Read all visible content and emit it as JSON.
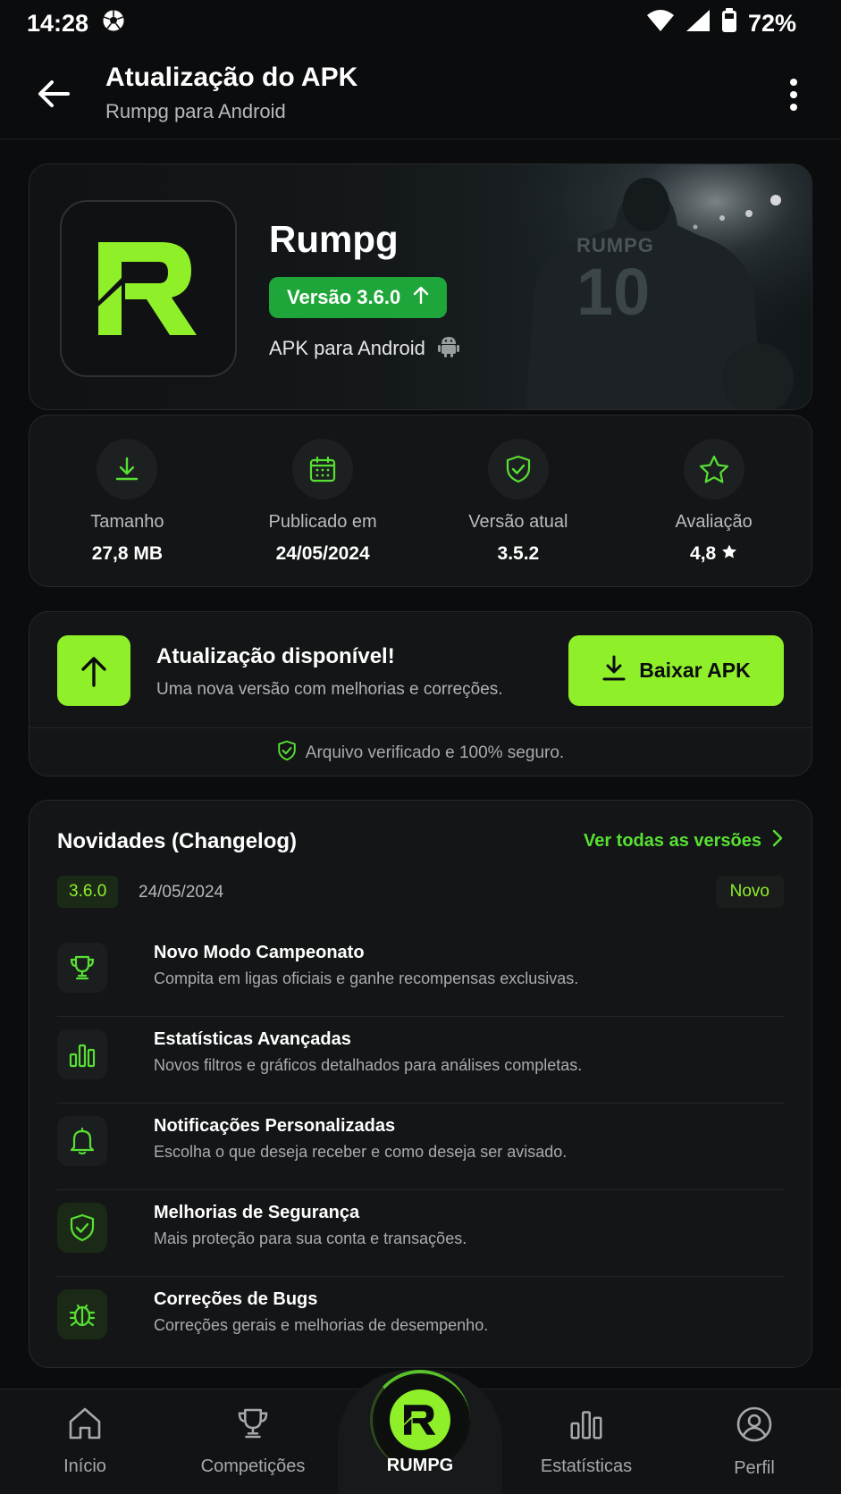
{
  "status": {
    "time": "14:28",
    "battery": "72%"
  },
  "appbar": {
    "title": "Atualização do APK",
    "subtitle": "Rumpg para Android"
  },
  "hero": {
    "app_name": "Rumpg",
    "version_label": "Versão 3.6.0",
    "platform_label": "APK para Android",
    "jersey_text": "RUMPG",
    "jersey_number": "10"
  },
  "stats": [
    {
      "icon": "download-icon",
      "label": "Tamanho",
      "value": "27,8 MB"
    },
    {
      "icon": "calendar-icon",
      "label": "Publicado em",
      "value": "24/05/2024"
    },
    {
      "icon": "shield-check-icon",
      "label": "Versão atual",
      "value": "3.5.2"
    },
    {
      "icon": "star-icon",
      "label": "Avaliação",
      "value": "4,8"
    }
  ],
  "update": {
    "title": "Atualização disponível!",
    "description": "Uma nova versão com melhorias e correções.",
    "button_label": "Baixar APK",
    "verified_text": "Arquivo verificado e 100% seguro."
  },
  "changelog": {
    "title": "Novidades (Changelog)",
    "see_all": "Ver todas as versões",
    "version": "3.6.0",
    "date": "24/05/2024",
    "new_tag": "Novo",
    "items": [
      {
        "icon": "trophy-icon",
        "title": "Novo Modo Campeonato",
        "desc": "Compita em ligas oficiais e ganhe recompensas exclusivas."
      },
      {
        "icon": "bar-chart-icon",
        "title": "Estatísticas Avançadas",
        "desc": "Novos filtros e gráficos detalhados para análises completas."
      },
      {
        "icon": "bell-icon",
        "title": "Notificações Personalizadas",
        "desc": "Escolha o que deseja receber e como deseja ser avisado."
      },
      {
        "icon": "shield-check-icon",
        "title": "Melhorias de Segurança",
        "desc": "Mais proteção para sua conta e transações."
      },
      {
        "icon": "bug-icon",
        "title": "Correções de Bugs",
        "desc": "Correções gerais e melhorias de desempenho."
      }
    ]
  },
  "nav": {
    "items": [
      {
        "icon": "home-icon",
        "label": "Início"
      },
      {
        "icon": "trophy-icon",
        "label": "Competições"
      },
      {
        "icon": "rumpg-logo",
        "label": "RUMPG"
      },
      {
        "icon": "bar-chart-icon",
        "label": "Estatísticas"
      },
      {
        "icon": "profile-icon",
        "label": "Perfil"
      }
    ]
  },
  "colors": {
    "accent": "#8ff02a",
    "accent_text": "#58e033",
    "pill": "#1fa63a",
    "background": "#0b0c0d",
    "card": "#131516"
  }
}
